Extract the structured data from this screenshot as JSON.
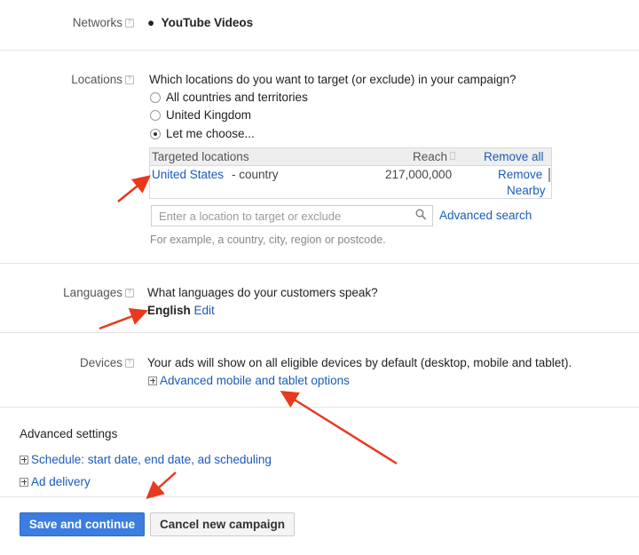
{
  "networks": {
    "label": "Networks",
    "value": "YouTube Videos"
  },
  "locations": {
    "label": "Locations",
    "question": "Which locations do you want to target (or exclude) in your campaign?",
    "options": [
      {
        "label": "All countries and territories",
        "selected": false
      },
      {
        "label": "United Kingdom",
        "selected": false
      },
      {
        "label": "Let me choose...",
        "selected": true
      }
    ],
    "table": {
      "headers": {
        "location": "Targeted locations",
        "reach": "Reach",
        "remove_all": "Remove all"
      },
      "rows": [
        {
          "name": "United States",
          "type": "- country",
          "reach": "217,000,000",
          "remove": "Remove",
          "nearby": "Nearby"
        }
      ]
    },
    "search_placeholder": "Enter a location to target or exclude",
    "advanced_search": "Advanced search",
    "hint": "For example, a country, city, region or postcode."
  },
  "languages": {
    "label": "Languages",
    "question": "What languages do your customers speak?",
    "value": "English",
    "edit": "Edit"
  },
  "devices": {
    "label": "Devices",
    "description": "Your ads will show on all eligible devices by default (desktop, mobile and tablet).",
    "advanced": "Advanced mobile and tablet options"
  },
  "advanced_settings": {
    "title": "Advanced settings",
    "items": [
      "Schedule: start date, end date, ad scheduling",
      "Ad delivery"
    ]
  },
  "buttons": {
    "save": "Save and continue",
    "cancel": "Cancel new campaign"
  },
  "colors": {
    "link": "#1a5bb8",
    "primary_button": "#3b7de0",
    "annotation_arrow": "#e8391e"
  }
}
